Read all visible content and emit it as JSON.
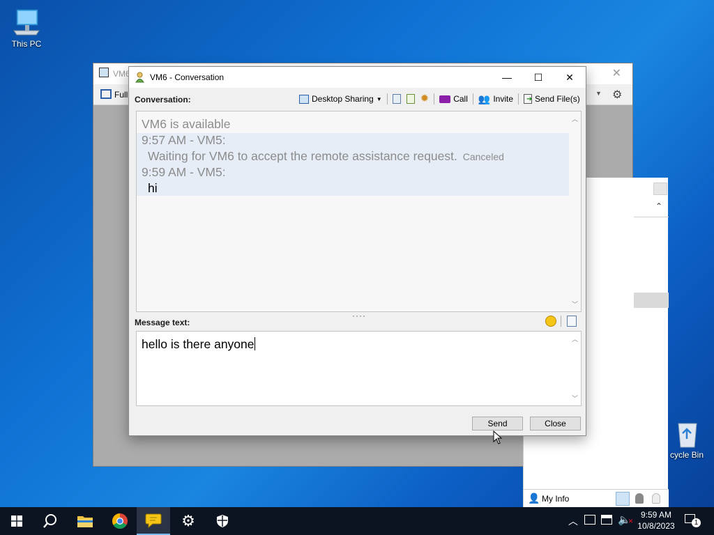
{
  "desktop": {
    "icons": [
      {
        "label": "This PC"
      },
      {
        "label": "cycle Bin"
      }
    ]
  },
  "background_window": {
    "title": "VM6",
    "toolbar_label": "Full"
  },
  "conversation": {
    "title": "VM6 - Conversation",
    "conversation_label": "Conversation:",
    "toolbar": {
      "desktop_sharing": "Desktop Sharing",
      "call": "Call",
      "invite": "Invite",
      "send_files": "Send File(s)"
    },
    "history": {
      "status": "VM6 is available",
      "messages": [
        {
          "header": "9:57 AM - VM5:",
          "text": "Waiting for VM6 to accept the remote assistance request.",
          "note": "Canceled"
        },
        {
          "header": "9:59 AM - VM5:",
          "text": "hi"
        }
      ]
    },
    "message_label": "Message text:",
    "message_value": "hello is there anyone",
    "send_label": "Send",
    "close_label": "Close"
  },
  "side_panel": {
    "my_info": "My Info"
  },
  "taskbar": {
    "apps": [
      "start",
      "search",
      "file-explorer",
      "chrome",
      "messenger",
      "settings",
      "security"
    ],
    "time": "9:59 AM",
    "date": "10/8/2023",
    "notification_count": "1"
  },
  "colors": {
    "history_highlight": "#e6edf7",
    "muted_text": "#8c8c8c",
    "taskbar": "#0d1421",
    "active_app_underline": "#76b9ed"
  }
}
